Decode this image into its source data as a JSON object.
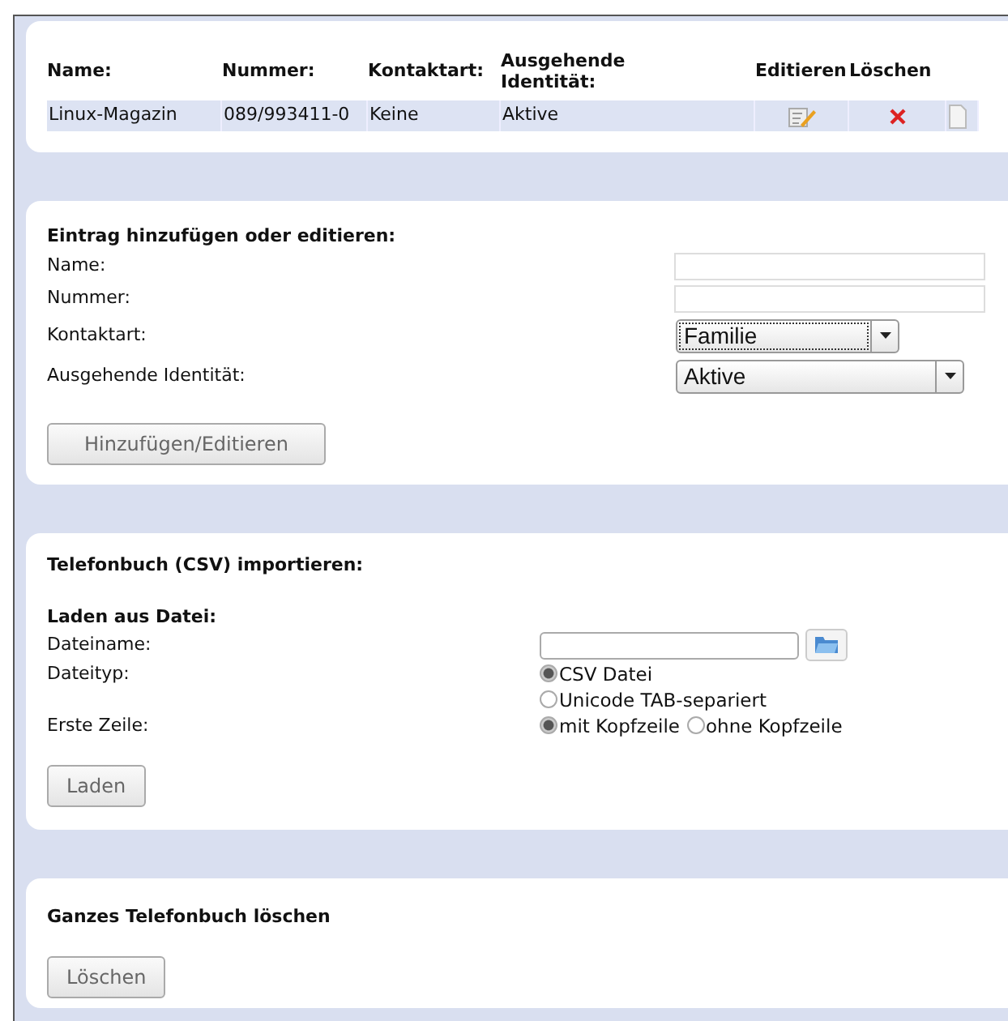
{
  "contacts": {
    "columns": [
      "Name:",
      "Nummer:",
      "Kontaktart:",
      "Ausgehende Identität:",
      "Editieren",
      "Löschen"
    ],
    "rows": [
      {
        "cells": [
          "Linux-Magazin",
          "089/993411-0",
          "Keine",
          "Aktive"
        ]
      }
    ]
  },
  "edit_form": {
    "title": "Eintrag hinzufügen oder editieren:",
    "fields": [
      {
        "kind": "text",
        "label": "Name:"
      },
      {
        "kind": "text",
        "label": "Nummer:"
      },
      {
        "kind": "select",
        "label": "Kontaktart:",
        "value": "Familie",
        "focused": true
      },
      {
        "kind": "select",
        "label": "Ausgehende Identität:",
        "value": "Aktive",
        "focused": false
      }
    ],
    "button": "Hinzufügen/Editieren"
  },
  "import": {
    "title": "Telefonbuch (CSV) importieren:",
    "subtitle": "Laden aus Datei:",
    "fields": [
      {
        "kind": "file",
        "label": "Dateiname:"
      },
      {
        "kind": "radio-stack",
        "label": "Dateityp:",
        "options": [
          {
            "label": "CSV Datei",
            "selected": true
          },
          {
            "label": "Unicode TAB-separiert",
            "selected": false
          }
        ]
      },
      {
        "kind": "radio-inline",
        "label": "Erste Zeile:",
        "options": [
          {
            "label": "mit Kopfzeile",
            "selected": true
          },
          {
            "label": "ohne Kopfzeile",
            "selected": false
          }
        ]
      }
    ],
    "button": "Laden"
  },
  "delete_all": {
    "title": "Ganzes Telefonbuch löschen",
    "button": "Löschen"
  }
}
